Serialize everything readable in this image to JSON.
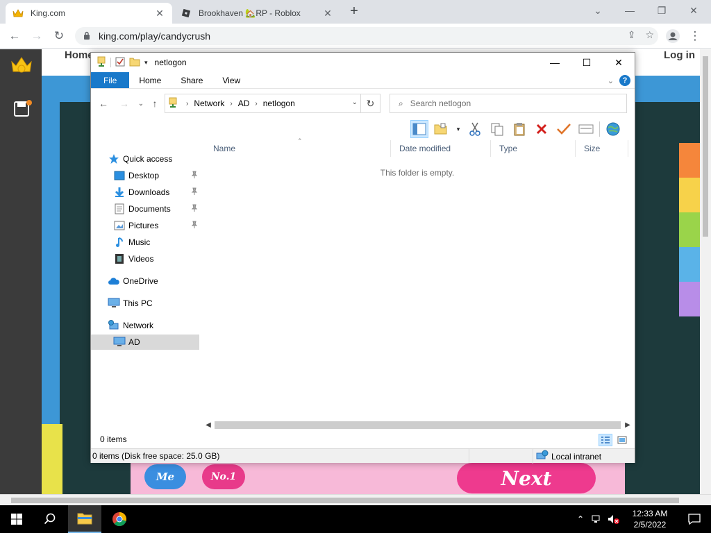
{
  "browser": {
    "tabs": [
      {
        "title": "King.com",
        "active": true,
        "favicon": "crown-icon"
      },
      {
        "title": "Brookhaven 🏡RP - Roblox",
        "active": false,
        "favicon": "roblox-icon"
      }
    ],
    "new_tab": "+",
    "url": "king.com/play/candycrush"
  },
  "site": {
    "nav_home": "Home",
    "nav_login": "Log in",
    "btn_me": "Me",
    "btn_no1": "No.1",
    "btn_next": "Next"
  },
  "explorer": {
    "window_title": "netlogon",
    "ribbon_tabs": [
      "File",
      "Home",
      "Share",
      "View"
    ],
    "breadcrumbs": [
      "Network",
      "AD",
      "netlogon"
    ],
    "search_placeholder": "Search netlogon",
    "nav": {
      "quick_access": "Quick access",
      "desktop": "Desktop",
      "downloads": "Downloads",
      "documents": "Documents",
      "pictures": "Pictures",
      "music": "Music",
      "videos": "Videos",
      "onedrive": "OneDrive",
      "this_pc": "This PC",
      "network": "Network",
      "ad": "AD"
    },
    "columns": [
      "Name",
      "Date modified",
      "Type",
      "Size"
    ],
    "empty_message": "This folder is empty.",
    "status_items": "0 items",
    "details_bar": "0 items (Disk free space: 25.0 GB)",
    "zone": "Local intranet"
  },
  "taskbar": {
    "time": "12:33 AM",
    "date": "2/5/2022"
  },
  "colors": {
    "ribbon_file": "#1979ca",
    "selection": "#cce8ff",
    "taskbar": "#000000"
  }
}
